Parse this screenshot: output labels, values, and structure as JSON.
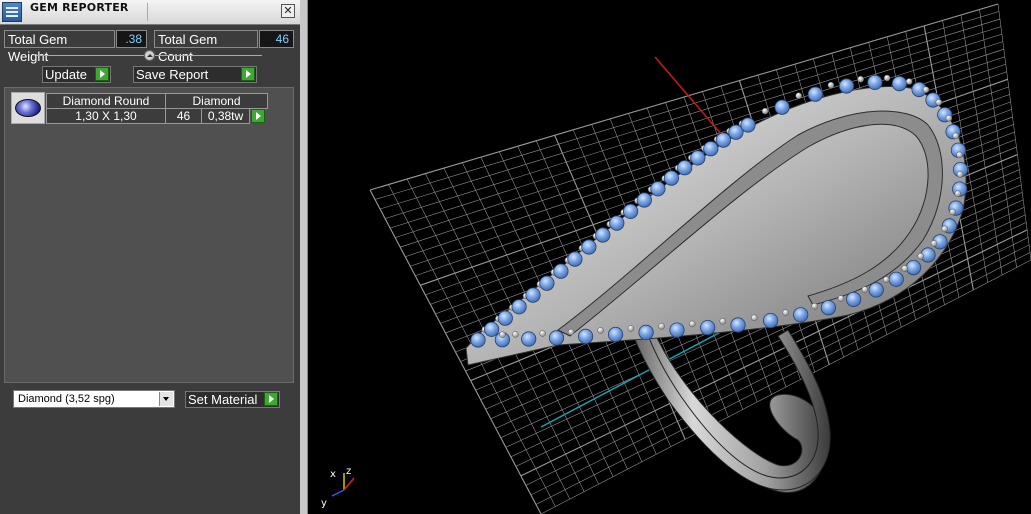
{
  "window": {
    "title": "GEM REPORTER",
    "close_label": "✕"
  },
  "totals": {
    "weight_label": "Total Gem Weight",
    "weight_value": ".38",
    "count_label": "Total Gem Count",
    "count_value": "46"
  },
  "actions": {
    "update_label": "Update",
    "save_report_label": "Save Report"
  },
  "gem_table": {
    "headers": [
      "Diamond Round",
      "Diamond"
    ],
    "rows": [
      {
        "size": "1,30 X 1,30",
        "count": "46",
        "weight": "0,38tw"
      }
    ]
  },
  "material": {
    "selected": "Diamond     (3,52 spg)",
    "set_label": "Set Material"
  },
  "viewport": {
    "axis_labels": {
      "x": "x",
      "y": "y",
      "z": "z"
    },
    "colors": {
      "background": "#000000",
      "grid": "#9a9a9a",
      "x_axis": "#d11b1b",
      "y_axis": "#1aa0b5",
      "metal": "#b9b9b9",
      "gem": "#6f9fe0"
    }
  }
}
